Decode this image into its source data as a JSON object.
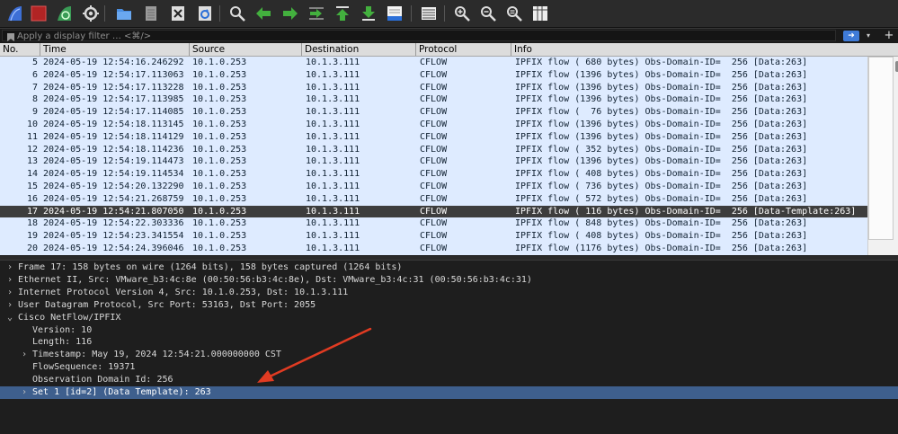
{
  "toolbar": {
    "items": [
      {
        "name": "start-capture-icon",
        "color": "#3d6fd6"
      },
      {
        "name": "stop-capture-icon",
        "color": "#b12424"
      },
      {
        "name": "restart-capture-icon",
        "color": "#3a9b56"
      },
      {
        "name": "capture-options-icon",
        "color": "#d9d9d9"
      },
      {
        "name": "open-file-icon",
        "color": "#4b8fe2"
      },
      {
        "name": "save-file-icon",
        "color": "#9a9a9a"
      },
      {
        "name": "close-file-icon",
        "color": "#dddddd"
      },
      {
        "name": "reload-file-icon",
        "color": "#dddddd"
      },
      {
        "name": "find-packet-icon",
        "color": "#dddddd"
      },
      {
        "name": "go-back-icon",
        "color": "#43b03e"
      },
      {
        "name": "go-forward-icon",
        "color": "#43b03e"
      },
      {
        "name": "go-to-packet-icon",
        "color": "#43b03e"
      },
      {
        "name": "go-first-packet-icon",
        "color": "#43b03e"
      },
      {
        "name": "go-last-packet-icon",
        "color": "#43b03e"
      },
      {
        "name": "autoscroll-icon",
        "color": "#dddddd"
      },
      {
        "name": "colorize-icon",
        "color": "#dddddd"
      },
      {
        "name": "zoom-in-icon",
        "color": "#dddddd"
      },
      {
        "name": "zoom-out-icon",
        "color": "#dddddd"
      },
      {
        "name": "zoom-normal-icon",
        "color": "#dddddd"
      },
      {
        "name": "resize-columns-icon",
        "color": "#dddddd"
      }
    ]
  },
  "filter": {
    "placeholder": "Apply a display filter … <⌘/>",
    "apply_symbol": "➜",
    "dropdown_symbol": "▾",
    "add_symbol": "+"
  },
  "columns": [
    "No.",
    "Time",
    "Source",
    "Destination",
    "Protocol",
    "Info"
  ],
  "packets": [
    {
      "no": "5",
      "time": "2024-05-19 12:54:16.246292",
      "src": "10.1.0.253",
      "dst": "10.1.3.111",
      "proto": "CFLOW",
      "info": "IPFIX flow ( 680 bytes) Obs-Domain-ID=  256 [Data:263]"
    },
    {
      "no": "6",
      "time": "2024-05-19 12:54:17.113063",
      "src": "10.1.0.253",
      "dst": "10.1.3.111",
      "proto": "CFLOW",
      "info": "IPFIX flow (1396 bytes) Obs-Domain-ID=  256 [Data:263]"
    },
    {
      "no": "7",
      "time": "2024-05-19 12:54:17.113228",
      "src": "10.1.0.253",
      "dst": "10.1.3.111",
      "proto": "CFLOW",
      "info": "IPFIX flow (1396 bytes) Obs-Domain-ID=  256 [Data:263]"
    },
    {
      "no": "8",
      "time": "2024-05-19 12:54:17.113985",
      "src": "10.1.0.253",
      "dst": "10.1.3.111",
      "proto": "CFLOW",
      "info": "IPFIX flow (1396 bytes) Obs-Domain-ID=  256 [Data:263]"
    },
    {
      "no": "9",
      "time": "2024-05-19 12:54:17.114085",
      "src": "10.1.0.253",
      "dst": "10.1.3.111",
      "proto": "CFLOW",
      "info": "IPFIX flow (  76 bytes) Obs-Domain-ID=  256 [Data:263]"
    },
    {
      "no": "10",
      "time": "2024-05-19 12:54:18.113145",
      "src": "10.1.0.253",
      "dst": "10.1.3.111",
      "proto": "CFLOW",
      "info": "IPFIX flow (1396 bytes) Obs-Domain-ID=  256 [Data:263]"
    },
    {
      "no": "11",
      "time": "2024-05-19 12:54:18.114129",
      "src": "10.1.0.253",
      "dst": "10.1.3.111",
      "proto": "CFLOW",
      "info": "IPFIX flow (1396 bytes) Obs-Domain-ID=  256 [Data:263]"
    },
    {
      "no": "12",
      "time": "2024-05-19 12:54:18.114236",
      "src": "10.1.0.253",
      "dst": "10.1.3.111",
      "proto": "CFLOW",
      "info": "IPFIX flow ( 352 bytes) Obs-Domain-ID=  256 [Data:263]"
    },
    {
      "no": "13",
      "time": "2024-05-19 12:54:19.114473",
      "src": "10.1.0.253",
      "dst": "10.1.3.111",
      "proto": "CFLOW",
      "info": "IPFIX flow (1396 bytes) Obs-Domain-ID=  256 [Data:263]"
    },
    {
      "no": "14",
      "time": "2024-05-19 12:54:19.114534",
      "src": "10.1.0.253",
      "dst": "10.1.3.111",
      "proto": "CFLOW",
      "info": "IPFIX flow ( 408 bytes) Obs-Domain-ID=  256 [Data:263]"
    },
    {
      "no": "15",
      "time": "2024-05-19 12:54:20.132290",
      "src": "10.1.0.253",
      "dst": "10.1.3.111",
      "proto": "CFLOW",
      "info": "IPFIX flow ( 736 bytes) Obs-Domain-ID=  256 [Data:263]"
    },
    {
      "no": "16",
      "time": "2024-05-19 12:54:21.268759",
      "src": "10.1.0.253",
      "dst": "10.1.3.111",
      "proto": "CFLOW",
      "info": "IPFIX flow ( 572 bytes) Obs-Domain-ID=  256 [Data:263]"
    },
    {
      "no": "17",
      "time": "2024-05-19 12:54:21.807050",
      "src": "10.1.0.253",
      "dst": "10.1.3.111",
      "proto": "CFLOW",
      "info": "IPFIX flow ( 116 bytes) Obs-Domain-ID=  256 [Data-Template:263]",
      "selected": true
    },
    {
      "no": "18",
      "time": "2024-05-19 12:54:22.303336",
      "src": "10.1.0.253",
      "dst": "10.1.3.111",
      "proto": "CFLOW",
      "info": "IPFIX flow ( 848 bytes) Obs-Domain-ID=  256 [Data:263]"
    },
    {
      "no": "19",
      "time": "2024-05-19 12:54:23.341554",
      "src": "10.1.0.253",
      "dst": "10.1.3.111",
      "proto": "CFLOW",
      "info": "IPFIX flow ( 408 bytes) Obs-Domain-ID=  256 [Data:263]"
    },
    {
      "no": "20",
      "time": "2024-05-19 12:54:24.396046",
      "src": "10.1.0.253",
      "dst": "10.1.3.111",
      "proto": "CFLOW",
      "info": "IPFIX flow (1176 bytes) Obs-Domain-ID=  256 [Data:263]"
    }
  ],
  "details": [
    {
      "text": "Frame 17: 158 bytes on wire (1264 bits), 158 bytes captured (1264 bits)",
      "level": 0,
      "caret": "›"
    },
    {
      "text": "Ethernet II, Src: VMware_b3:4c:8e (00:50:56:b3:4c:8e), Dst: VMware_b3:4c:31 (00:50:56:b3:4c:31)",
      "level": 0,
      "caret": "›"
    },
    {
      "text": "Internet Protocol Version 4, Src: 10.1.0.253, Dst: 10.1.3.111",
      "level": 0,
      "caret": "›"
    },
    {
      "text": "User Datagram Protocol, Src Port: 53163, Dst Port: 2055",
      "level": 0,
      "caret": "›"
    },
    {
      "text": "Cisco NetFlow/IPFIX",
      "level": 0,
      "caret": "⌄"
    },
    {
      "text": "Version: 10",
      "level": 1,
      "caret": ""
    },
    {
      "text": "Length: 116",
      "level": 1,
      "caret": ""
    },
    {
      "text": "Timestamp: May 19, 2024 12:54:21.000000000 CST",
      "level": 1,
      "caret": "›"
    },
    {
      "text": "FlowSequence: 19371",
      "level": 1,
      "caret": ""
    },
    {
      "text": "Observation Domain Id: 256",
      "level": 1,
      "caret": ""
    },
    {
      "text": "Set 1 [id=2] (Data Template): 263",
      "level": 1,
      "caret": "›",
      "selected": true
    }
  ]
}
